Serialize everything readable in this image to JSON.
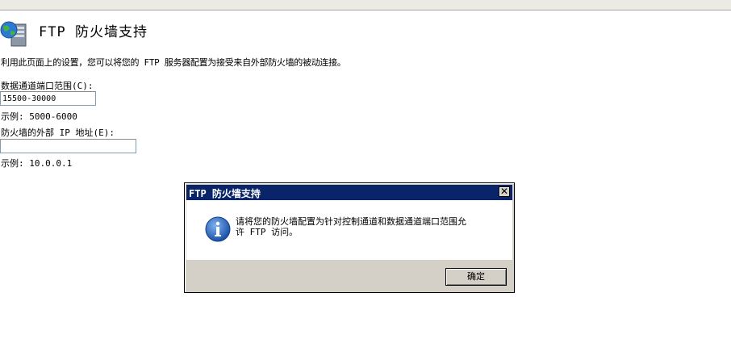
{
  "header": {
    "title": "FTP 防火墙支持",
    "icon": "globe-server-icon"
  },
  "description": "利用此页面上的设置，您可以将您的 FTP 服务器配置为接受来自外部防火墙的被动连接。",
  "port_range": {
    "label": "数据通道端口范围(C):",
    "value": "15500-30000",
    "example": "示例: 5000-6000"
  },
  "external_ip": {
    "label": "防火墙的外部 IP 地址(E):",
    "value": "",
    "example": "示例: 10.0.0.1"
  },
  "dialog": {
    "title": "FTP 防火墙支持",
    "icon": "info-icon",
    "message_line1": "请将您的防火墙配置为针对控制通道和数据通道端口范围允",
    "message_line2": "许 FTP 访问。",
    "ok_label": "确定",
    "close_glyph": "✕"
  },
  "colors": {
    "titlebar": "#0a246a",
    "dialog_bg": "#d4d0c8"
  }
}
